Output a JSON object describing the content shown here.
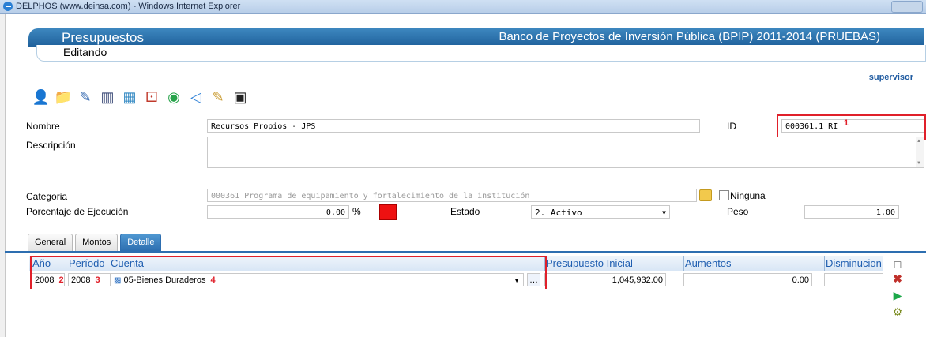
{
  "window": {
    "title": "DELPHOS (www.deinsa.com) - Windows Internet Explorer"
  },
  "header": {
    "title": "Presupuestos",
    "subtitle": "Editando",
    "bank": "Banco de Proyectos de Inversión Pública (BPIP) 2011-2014 (PRUEBAS)"
  },
  "user": "supervisor",
  "toolbar": [
    "user-icon",
    "folder-icon",
    "edit-icon",
    "hierarchy-icon",
    "table-icon",
    "pdf-icon",
    "globe-icon",
    "share-icon",
    "scroll-icon",
    "save-icon"
  ],
  "form": {
    "nombre_label": "Nombre",
    "nombre_value": "Recursos Propios - JPS",
    "id_label": "ID",
    "id_value": "000361.1 RI",
    "descripcion_label": "Descripción",
    "descripcion_value": "",
    "categoria_label": "Categoria",
    "categoria_value": "000361 Programa de equipamiento y fortalecimiento de la institución",
    "ninguna_label": "Ninguna",
    "porcentaje_label": "Porcentaje de Ejecución",
    "porcentaje_value": "0.00",
    "percent_sign": "%",
    "estado_label": "Estado",
    "estado_value": "2. Activo",
    "peso_label": "Peso",
    "peso_value": "1.00"
  },
  "tabs": [
    "General",
    "Montos",
    "Detalle"
  ],
  "grid": {
    "columns": [
      "Año",
      "Período",
      "Cuenta",
      "Presupuesto Inicial",
      "Aumentos",
      "Disminucion"
    ],
    "row": {
      "anio": "2008",
      "periodo": "2008",
      "cuenta": "05-Bienes Duraderos",
      "presupuesto": "1,045,932.00",
      "aumentos": "0.00",
      "disminucion": ""
    }
  },
  "markers": [
    "1",
    "2",
    "3",
    "4"
  ],
  "colors": {
    "header": "#2a72b0",
    "highlight": "#e0202a",
    "estado_swatch": "#ee1111"
  }
}
